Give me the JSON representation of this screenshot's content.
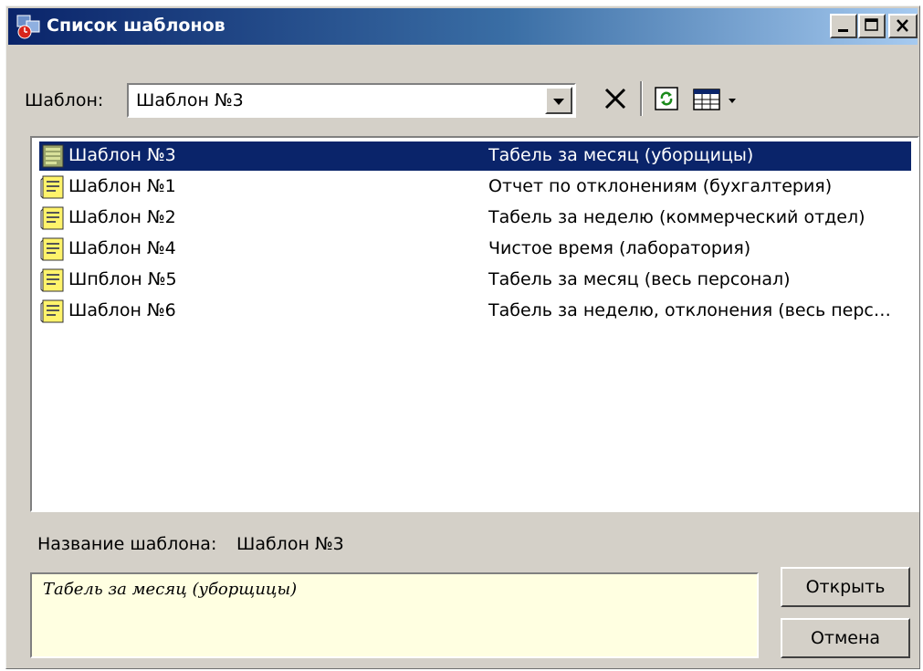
{
  "window": {
    "title": "Список шаблонов"
  },
  "toolbar": {
    "template_label": "Шаблон:",
    "template_value": "Шаблон №3"
  },
  "templates": [
    {
      "name": "Шаблон №3",
      "description": "Табель за месяц (уборщицы)",
      "selected": true
    },
    {
      "name": "Шаблон №1",
      "description": "Отчет по отклонениям (бухгалтерия)",
      "selected": false
    },
    {
      "name": "Шаблон №2",
      "description": "Табель за неделю (коммерческий отдел)",
      "selected": false
    },
    {
      "name": "Шаблон №4",
      "description": "Чистое время (лаборатория)",
      "selected": false
    },
    {
      "name": "Шпблон №5",
      "description": "Табель за месяц (весь персонал)",
      "selected": false
    },
    {
      "name": "Шаблон №6",
      "description": "Табель за неделю, отклонения (весь перс…",
      "selected": false
    }
  ],
  "details": {
    "name_label": "Название шаблона:",
    "name_value": "Шаблон №3",
    "description": "Табель за месяц (уборщицы)"
  },
  "buttons": {
    "open": "Открыть",
    "cancel": "Отмена"
  },
  "colors": {
    "selection": "#0a246a",
    "title_start": "#0a246a",
    "title_end": "#a6caf0",
    "face": "#d4d0c8",
    "note_bg": "#ffffe1"
  }
}
